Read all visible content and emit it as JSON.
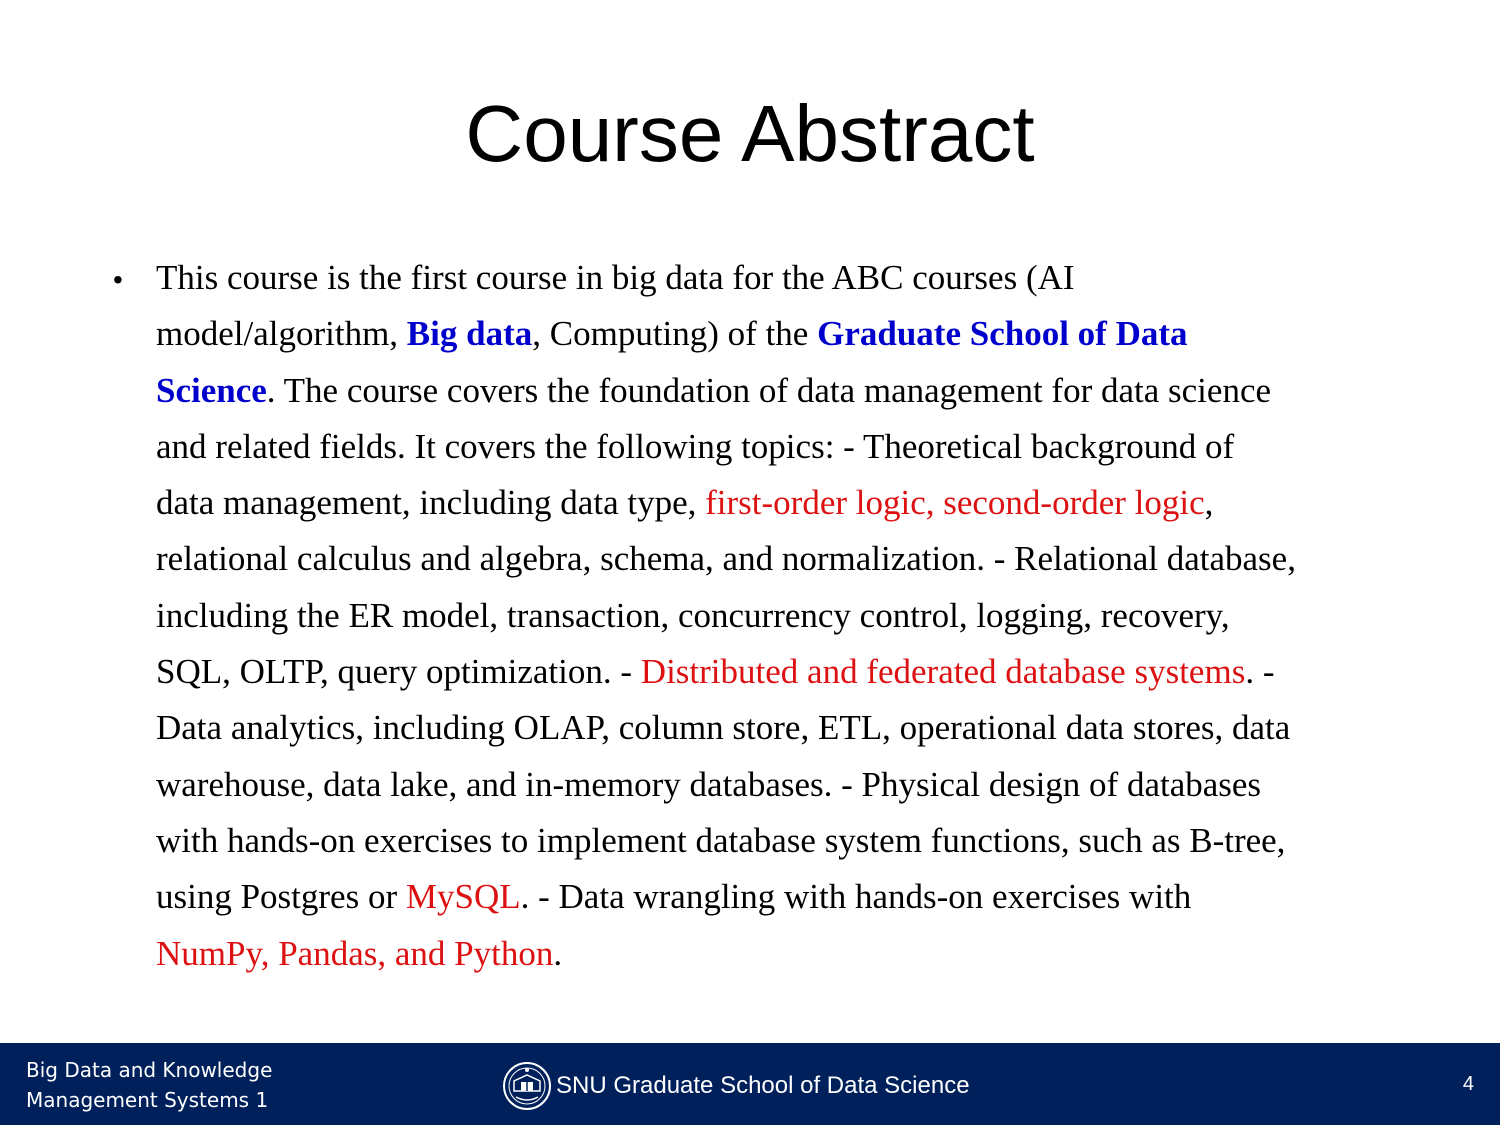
{
  "slide": {
    "title": "Course Abstract",
    "bullet_symbol": "•",
    "lines": [
      [
        {
          "text": "This course is the first course in big data for the ABC courses (AI"
        }
      ],
      [
        {
          "text": "model/algorithm, "
        },
        {
          "text": "Big data",
          "style": "blue"
        },
        {
          "text": ", Computing) of the "
        },
        {
          "text": "Graduate School of Data",
          "style": "blue"
        }
      ],
      [
        {
          "text": "Science",
          "style": "blue"
        },
        {
          "text": ". The course covers the foundation of data management for data science"
        }
      ],
      [
        {
          "text": "and related fields. It covers the following topics: - Theoretical background of"
        }
      ],
      [
        {
          "text": "data management, including data type, "
        },
        {
          "text": "first-order logic, second-order logic",
          "style": "red"
        },
        {
          "text": ","
        }
      ],
      [
        {
          "text": "relational calculus and algebra, schema, and normalization. - Relational database,"
        }
      ],
      [
        {
          "text": "including the ER model, transaction, concurrency control, logging, recovery,"
        }
      ],
      [
        {
          "text": "SQL, OLTP, query optimization. - "
        },
        {
          "text": "Distributed and federated database systems",
          "style": "red"
        },
        {
          "text": ". -"
        }
      ],
      [
        {
          "text": "Data analytics, including OLAP, column store, ETL, operational data stores, data"
        }
      ],
      [
        {
          "text": "warehouse, data lake, and in-memory databases. - Physical design of databases"
        }
      ],
      [
        {
          "text": "with hands-on exercises to implement database system functions, such as B-tree,"
        }
      ],
      [
        {
          "text": "using Postgres or "
        },
        {
          "text": "MySQL",
          "style": "red"
        },
        {
          "text": ". - Data wrangling with hands-on exercises with"
        }
      ],
      [
        {
          "text": "NumPy, Pandas, and Python",
          "style": "red"
        },
        {
          "text": "."
        }
      ]
    ]
  },
  "footer": {
    "course_line1": "Big Data and Knowledge",
    "course_line2": "Management Systems 1",
    "school": "SNU Graduate School of Data Science",
    "logo_icon": "university-emblem-icon",
    "page_number": "4",
    "background_color": "#00205b"
  },
  "colors": {
    "highlight_blue": "#0000cc",
    "highlight_red": "#dd1111"
  }
}
